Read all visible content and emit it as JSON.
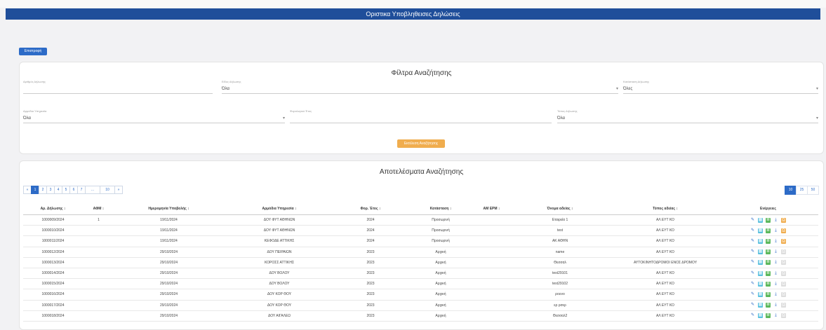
{
  "page_title": "Οριστικα Υποβληθεισες Δηλώσεις",
  "back_label": "Επιστροφή",
  "filters": {
    "title": "Φίλτρα Αναζήτησης",
    "fields": [
      {
        "label": "Αριθμός Δήλωσης",
        "value": ""
      },
      {
        "label": "Είδος Δήλωσης",
        "value": "Όλα"
      },
      {
        "label": "Κατάσταση Δήλωσης",
        "value": "Όλες"
      },
      {
        "label": "Αρμόδια Υπηρεσία",
        "value": "Όλα"
      },
      {
        "label": "Φορολογικό Έτος",
        "value": ""
      },
      {
        "label": "Τύπος Δήλωσης",
        "value": "Όλα"
      }
    ],
    "search_label": "Εκτέλεση Αναζήτησης"
  },
  "results": {
    "title": "Αποτελέσματα Αναζήτησης",
    "pager": [
      "«",
      "1",
      "2",
      "3",
      "4",
      "5",
      "6",
      "7",
      "...",
      "10",
      "»"
    ],
    "page_sizes": [
      "10",
      "25",
      "50"
    ],
    "columns": [
      "Αρ. Δήλωσης ↕",
      "ΑΦΜ ↕",
      "Ημερομηνία Υποβολής ↕",
      "Αρμόδια Υπηρεσία ↕",
      "Φορ. Έτος ↕",
      "Κατάσταση ↕",
      "ΑΜ ΕΡΜ ↕",
      "Όνομα αδείας ↕",
      "Τύπος αδείας ↕",
      "Ενέργειες"
    ],
    "rows": [
      {
        "no": "1000009/2024",
        "afm": "1",
        "date": "19/11/2024",
        "office": "ΔΟΥ ΦΥΤ ΑΘΗΝΩΝ",
        "year": "2024",
        "status": "Προσωρινή",
        "am": "",
        "name": "Εταιρεία 1",
        "type": "ΑΛ ΕΥΤ ΚΟ",
        "print": "active"
      },
      {
        "no": "1000010/2024",
        "afm": "",
        "date": "19/11/2024",
        "office": "ΔΟΥ ΦΥΤ ΑΘΗΝΩΝ",
        "year": "2024",
        "status": "Προσωρινή",
        "am": "",
        "name": "test",
        "type": "ΑΛ ΕΥΤ ΚΟ",
        "print": "active"
      },
      {
        "no": "1000011/2024",
        "afm": "",
        "date": "19/11/2024",
        "office": "ΚΕΦΟΔΕ ΑΤΤΙΚΗΣ",
        "year": "2024",
        "status": "Προσωρινή",
        "am": "",
        "name": "ΑΚ ΑΘΗΝ",
        "type": "ΑΛ ΕΥΤ ΚΟ",
        "print": "active"
      },
      {
        "no": "1000012/2024",
        "afm": "",
        "date": "29/10/2024",
        "office": "ΔΟΥ ΠΕΙΡΑΙΩΝ",
        "year": "2023",
        "status": "Αρχική",
        "am": "",
        "name": "name",
        "type": "ΑΛ ΕΥΤ ΚΟ",
        "print": "disabled"
      },
      {
        "no": "1000013/2024",
        "afm": "",
        "date": "29/10/2024",
        "office": "ΚΟΡΟΣΣ ΑΤΤΙΚΗΣ",
        "year": "2023",
        "status": "Αρχική",
        "am": "",
        "name": "Θεσσαλ",
        "type": "ΑΥΤΟΚΙΝΗΤΟΔΡΟΜΟΙ ΕΝΟΣ ΔΡΟΜΟΥ",
        "print": "disabled"
      },
      {
        "no": "1000014/2024",
        "afm": "",
        "date": "29/10/2024",
        "office": "ΔΟΥ ΒΟΛΟΥ",
        "year": "2023",
        "status": "Αρχική",
        "am": "",
        "name": "test29101",
        "type": "ΑΛ ΕΥΤ ΚΟ",
        "print": "disabled"
      },
      {
        "no": "1000015/2024",
        "afm": "",
        "date": "29/10/2024",
        "office": "ΔΟΥ ΒΟΛΟΥ",
        "year": "2023",
        "status": "Αρχική",
        "am": "",
        "name": "test29102",
        "type": "ΑΛ ΕΥΤ ΚΟ",
        "print": "disabled"
      },
      {
        "no": "1000016/2024",
        "afm": "",
        "date": "29/10/2024",
        "office": "ΔΟΥ ΚΟΡ ΘΟΥ",
        "year": "2023",
        "status": "Αρχική",
        "am": "",
        "name": "ρουνο",
        "type": "ΑΛ ΕΥΤ ΚΟ",
        "print": "disabled"
      },
      {
        "no": "1000017/2024",
        "afm": "",
        "date": "29/10/2024",
        "office": "ΔΟΥ ΚΟΡ ΘΟΥ",
        "year": "2023",
        "status": "Αρχική",
        "am": "",
        "name": "ερ ρσερ",
        "type": "ΑΛ ΕΥΤ ΚΟ",
        "print": "disabled"
      },
      {
        "no": "1000018/2024",
        "afm": "",
        "date": "29/10/2024",
        "office": "ΔΟΥ ΑΙΓΑΛΕΩ",
        "year": "2023",
        "status": "Αρχική",
        "am": "",
        "name": "Θεσσαλ2",
        "type": "ΑΛ ΕΥΤ ΚΟ",
        "print": "disabled"
      }
    ]
  },
  "icons": {
    "edit": "pencil-icon",
    "view": "table-icon",
    "details": "list-icon",
    "download": "download-icon",
    "print": "print-icon"
  },
  "colors": {
    "header": "#1f4e9a",
    "primary": "#2d6bc7",
    "warning": "#f0ad4e",
    "success": "#5cb85c",
    "info": "#5bc0de"
  }
}
